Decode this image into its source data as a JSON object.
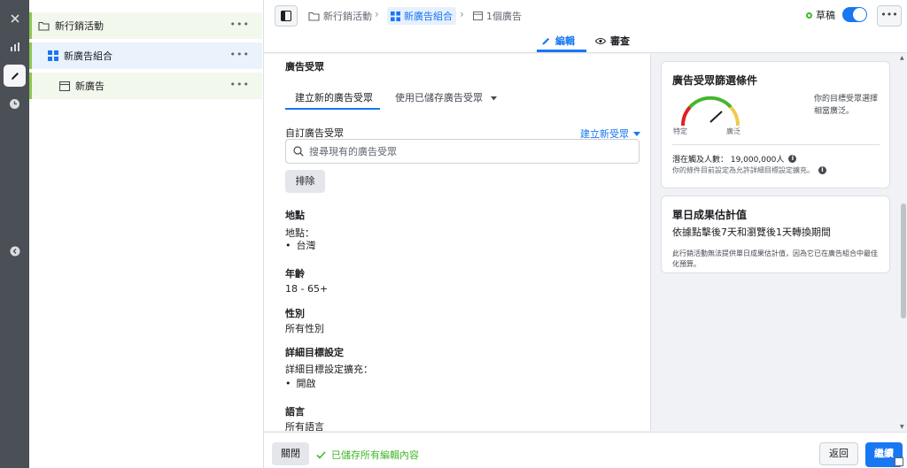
{
  "tree": {
    "campaign": "新行銷活動",
    "adset": "新廣告組合",
    "ad": "新廣告",
    "more": "•••"
  },
  "header": {
    "crumb_campaign": "新行銷活動",
    "crumb_adset": "新廣告組合",
    "crumb_ad": "1個廣告",
    "separator": "›",
    "draft": "草稿",
    "more": "•••",
    "tab_edit": "編輯",
    "tab_review": "審查"
  },
  "main": {
    "section_title": "廣告受眾",
    "subtab_new": "建立新的廣告受眾",
    "subtab_saved": "使用已儲存廣告受眾",
    "custom_audience_label": "自訂廣告受眾",
    "create_new": "建立新受眾",
    "search_placeholder": "搜尋現有的廣告受眾",
    "exclude": "排除",
    "location_heading": "地點",
    "location_sublabel": "地點：",
    "location_value": "台灣",
    "age_heading": "年齡",
    "age_value": "18 - 65+",
    "gender_heading": "性別",
    "gender_value": "所有性別",
    "detailed_heading": "詳細目標設定",
    "detailed_sublabel": "詳細目標設定擴充：",
    "detailed_value": "開啟",
    "language_heading": "語言",
    "language_value": "所有語言"
  },
  "audience_card": {
    "title": "廣告受眾篩選條件",
    "note": "你的目標受眾選擇相當廣泛。",
    "gauge_left": "特定",
    "gauge_right": "廣泛",
    "reach": "潛在觸及人數： 19,000,000人",
    "reach_note": "你的條件目前設定為允許詳細目標設定擴充。",
    "info_glyph": "i"
  },
  "estimate_card": {
    "title": "單日成果估計值",
    "subtitle": "依據點擊後7天和瀏覽後1天轉換期間",
    "desc": "此行銷活動無法提供單日成果估計值，因為它已在廣告組合中最佳化預算。"
  },
  "footer": {
    "close": "關閉",
    "saved": "已儲存所有編輯內容",
    "back": "返回",
    "continue": "繼續"
  },
  "colors": {
    "accent": "#1877f2",
    "success": "#42b72a",
    "rail": "#4b4f56"
  }
}
